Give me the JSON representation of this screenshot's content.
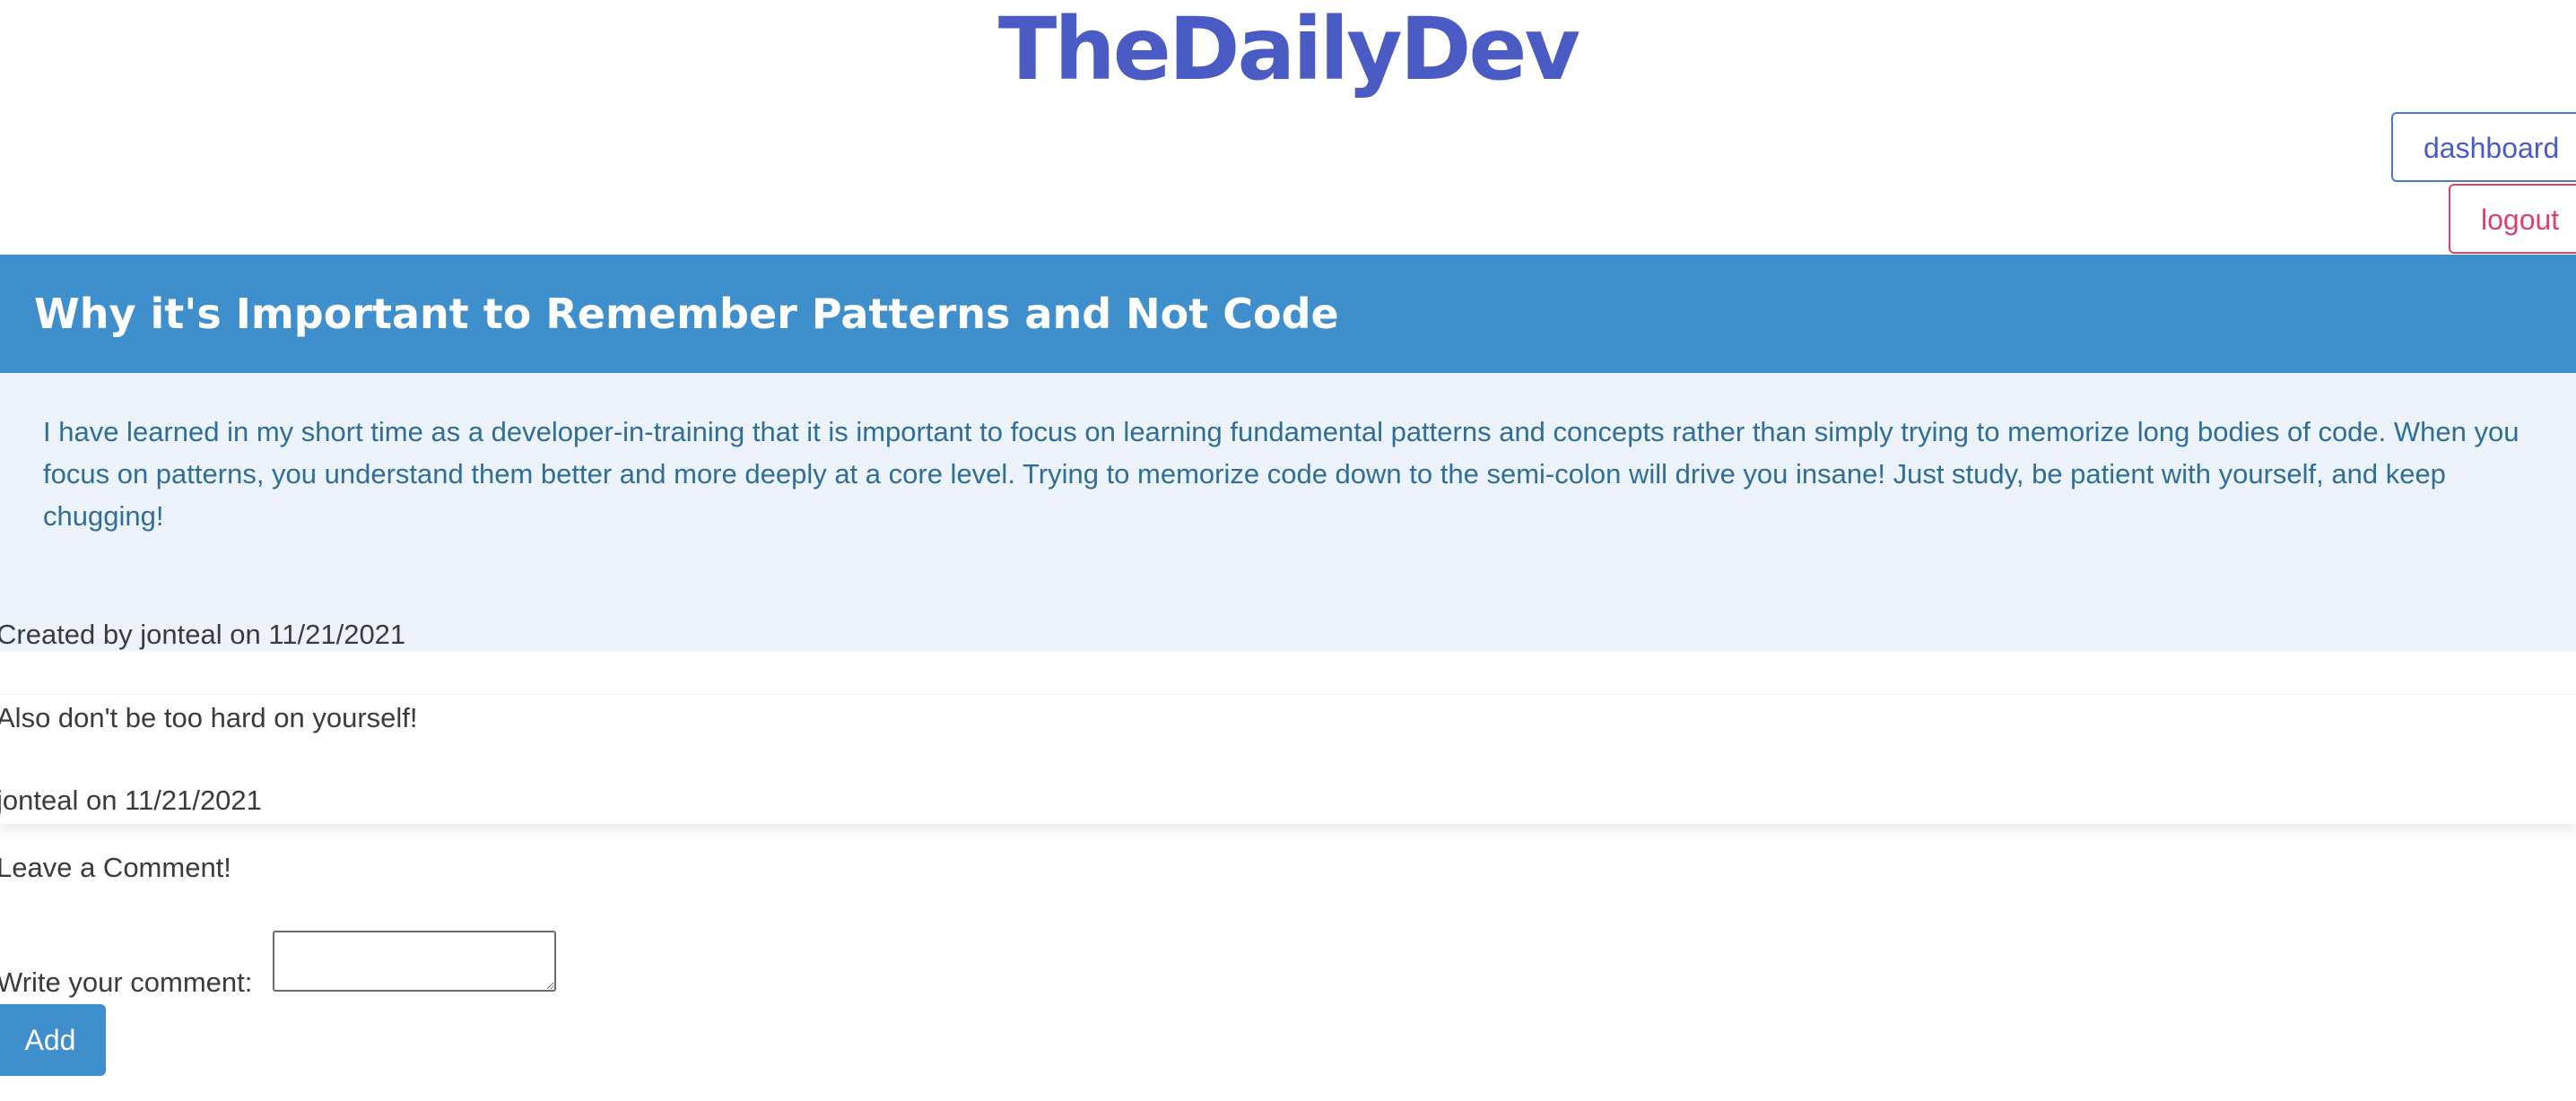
{
  "site": {
    "title": "TheDailyDev"
  },
  "nav": {
    "dashboard_label": "dashboard",
    "logout_label": "logout"
  },
  "post": {
    "title": "Why it's Important to Remember Patterns and Not Code",
    "content": "I have learned in my short time as a developer-in-training that it is important to focus on learning fundamental patterns and concepts rather than simply trying to memorize long bodies of code. When you focus on patterns, you understand them better and more deeply at a core level. Trying to memorize code down to the semi-colon will drive you insane! Just study, be patient with yourself, and keep chugging!",
    "meta": "Created by jonteal on 11/21/2021"
  },
  "comments": [
    {
      "text": "Also don't be too hard on yourself!",
      "meta": "jonteal on 11/21/2021"
    }
  ],
  "comment_form": {
    "heading": "Leave a Comment!",
    "label": "Write your comment:",
    "value": "",
    "submit_label": "Add"
  },
  "colors": {
    "brand": "#4a5bc4",
    "header_bg": "#3f8fcc",
    "body_bg": "#edf3fb",
    "logout": "#d9436a"
  }
}
